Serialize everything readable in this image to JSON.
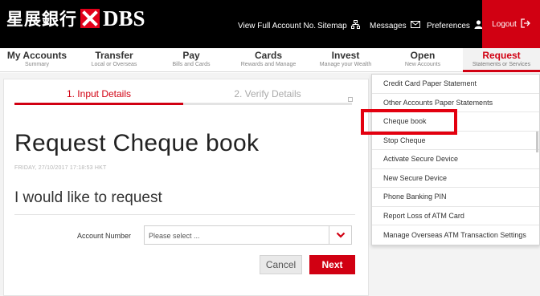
{
  "brand": {
    "chinese_name": "星展銀行",
    "name": "DBS",
    "accent_color": "#d10012"
  },
  "top_links": {
    "view_full_account": "View Full Account No.",
    "sitemap": "Sitemap",
    "messages": "Messages",
    "preferences": "Preferences",
    "logout": "Logout"
  },
  "nav": [
    {
      "label": "My Accounts",
      "sub": "Summary"
    },
    {
      "label": "Transfer",
      "sub": "Local or Overseas"
    },
    {
      "label": "Pay",
      "sub": "Bills and Cards"
    },
    {
      "label": "Cards",
      "sub": "Rewards and Manage"
    },
    {
      "label": "Invest",
      "sub": "Manage your Wealth"
    },
    {
      "label": "Open",
      "sub": "New Accounts"
    },
    {
      "label": "Request",
      "sub": "Statements or Services",
      "active": true
    }
  ],
  "steps": [
    {
      "label": "1. Input Details",
      "active": true
    },
    {
      "label": "2. Verify Details",
      "active": false
    }
  ],
  "page": {
    "title": "Request Cheque book",
    "timestamp": "FRIDAY, 27/10/2017 17:18:53 HKT",
    "section_title": "I would like to request"
  },
  "form": {
    "account_label": "Account Number",
    "account_select_value": "Please select ...",
    "cancel_label": "Cancel",
    "next_label": "Next"
  },
  "request_menu": [
    "Credit Card Paper Statement",
    "Other Accounts Paper Statements",
    "Cheque book",
    "Stop Cheque",
    "Activate Secure Device",
    "New Secure Device",
    "Phone Banking PIN",
    "Report Loss of ATM Card",
    "Manage Overseas ATM Transaction Settings"
  ],
  "highlighted_menu_item": "Cheque book"
}
